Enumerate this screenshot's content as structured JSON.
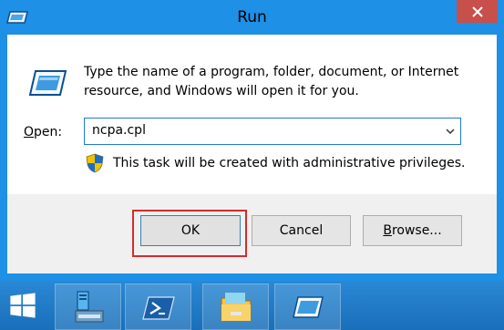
{
  "window": {
    "title": "Run",
    "close_icon": "close-icon"
  },
  "dialog": {
    "description": "Type the name of a program, folder, document, or Internet resource, and Windows will open it for you.",
    "open_label_accel": "O",
    "open_label_rest": "pen:",
    "open_value": "ncpa.cpl",
    "admin_note": "This task will be created with administrative privileges.",
    "buttons": {
      "ok": "OK",
      "cancel": "Cancel",
      "browse_accel": "B",
      "browse_rest": "rowse..."
    }
  },
  "taskbar": {
    "items": [
      {
        "icon": "windows-start-icon"
      },
      {
        "icon": "server-manager-icon"
      },
      {
        "icon": "powershell-icon"
      },
      {
        "icon": "file-explorer-icon"
      },
      {
        "icon": "run-icon"
      }
    ]
  },
  "colors": {
    "title_bar": "#1e90e6",
    "close_button": "#c7504a",
    "highlight_box": "#d62b2b",
    "taskbar": "#1a6fb9"
  }
}
